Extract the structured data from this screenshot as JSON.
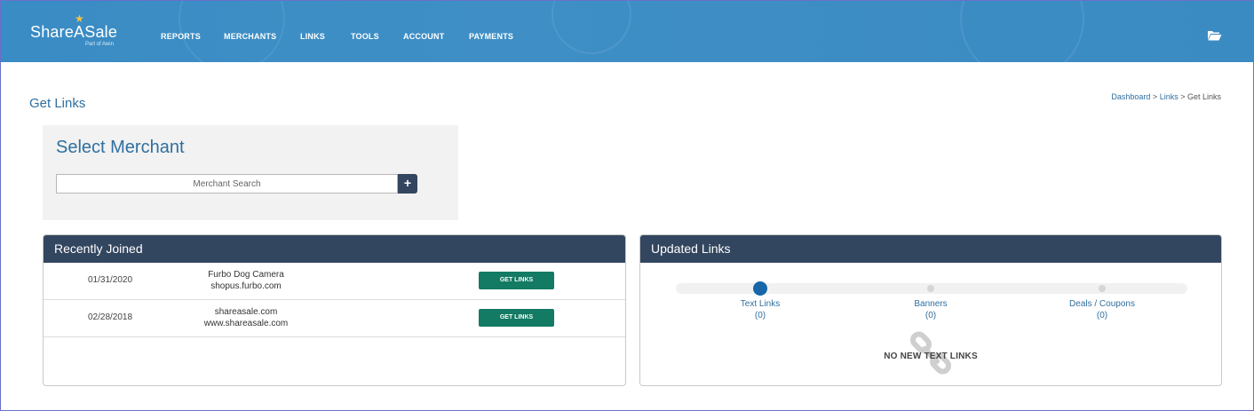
{
  "header": {
    "logo": {
      "name": "ShareASale",
      "tagline": "Part of Awin"
    },
    "nav": [
      "REPORTS",
      "MERCHANTS",
      "LINKS",
      "TOOLS",
      "ACCOUNT",
      "PAYMENTS"
    ],
    "icons": {
      "folder": "folder-open-icon",
      "star": "star-icon"
    }
  },
  "page": {
    "title": "Get Links",
    "breadcrumb": {
      "link1": "Dashboard",
      "sep1": " > ",
      "link2": "Links",
      "sep2": " > ",
      "current": "Get Links"
    }
  },
  "select_merchant": {
    "title": "Select Merchant",
    "search_placeholder": "Merchant Search",
    "search_value": "",
    "plus": "+"
  },
  "recently_joined": {
    "title": "Recently Joined",
    "rows": [
      {
        "date": "01/31/2020",
        "name": "Furbo Dog Camera",
        "url": "shopus.furbo.com",
        "button": "GET LINKS"
      },
      {
        "date": "02/28/2018",
        "name": "shareasale.com",
        "url": "www.shareasale.com",
        "button": "GET LINKS"
      }
    ]
  },
  "updated_links": {
    "title": "Updated Links",
    "tabs": [
      {
        "label": "Text Links",
        "count": "(0)",
        "active": true
      },
      {
        "label": "Banners",
        "count": "(0)",
        "active": false
      },
      {
        "label": "Deals / Coupons",
        "count": "(0)",
        "active": false
      }
    ],
    "empty_message": "NO NEW TEXT LINKS",
    "empty_icon": "link-icon"
  },
  "colors": {
    "header_bg": "#3b8bc3",
    "panel_header": "#33465f",
    "button_green": "#137a63",
    "accent_blue": "#2f6f9f",
    "active_dot": "#1766a8"
  }
}
